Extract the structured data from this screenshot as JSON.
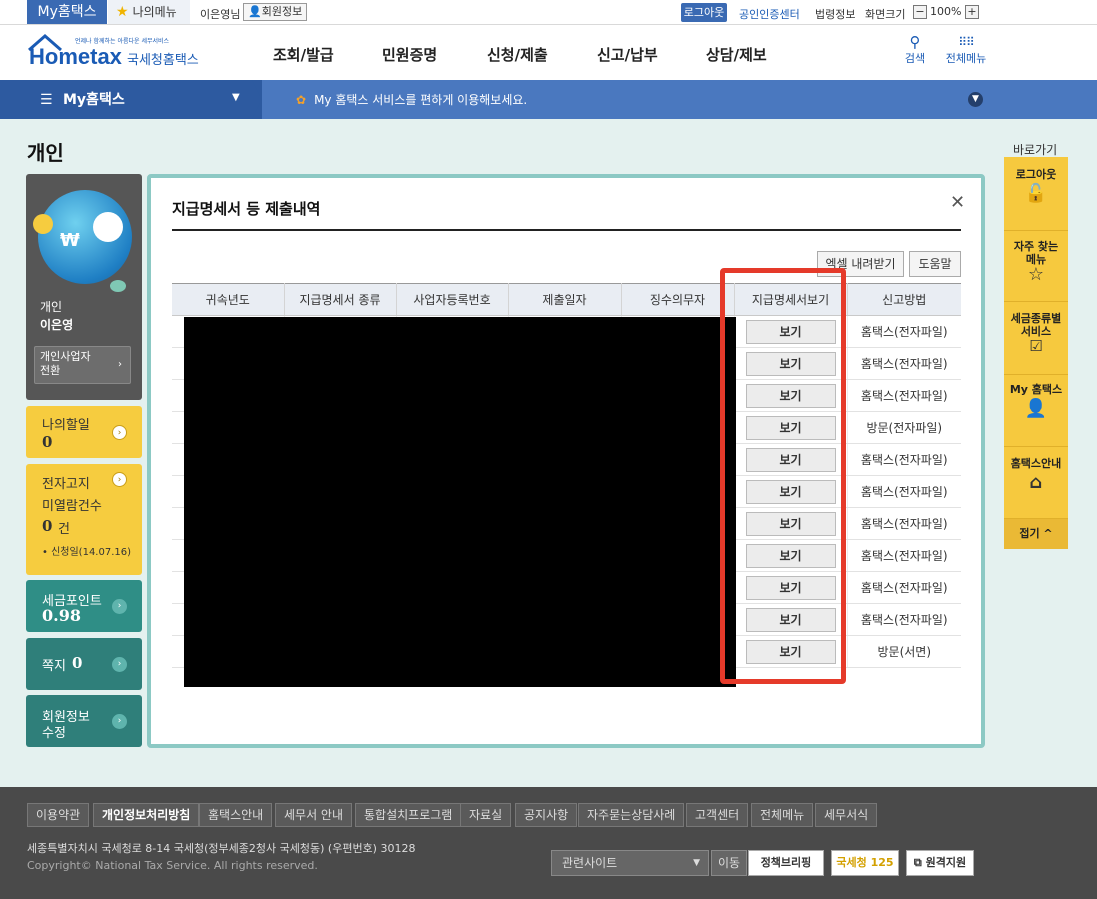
{
  "topbar": {
    "myhometax": "My홈택스",
    "mymenu": "나의메뉴",
    "user": "이은영님",
    "member_info": "회원정보",
    "logout": "로그아웃",
    "cert_center": "공인인증센터",
    "law_info": "법령정보",
    "screen_size": "화면크기",
    "zoom": "100%"
  },
  "header": {
    "logo_small": "언제나 함께하는 아름다운 세무서비스",
    "logo_main": "Hometax",
    "logo_sub": "국세청홈택스",
    "nav": [
      "조회/발급",
      "민원증명",
      "신청/제출",
      "신고/납부",
      "상담/제보"
    ],
    "search": "검색",
    "allmenu": "전체메뉴"
  },
  "bluebar": {
    "dropdown": "My홈택스",
    "message": "My 홈택스 서비스를 편하게 이용해보세요."
  },
  "page_title": "개인",
  "sidebar": {
    "profile_type": "개인",
    "profile_name": "이은영",
    "biz_switch": "개인사업자 전환",
    "todo_label": "나의할일",
    "todo_value": "0",
    "notice_label1": "전자고지",
    "notice_label2": "미열람건수",
    "notice_value": "0",
    "notice_unit": "건",
    "notice_date": "• 신청일(14.07.16)",
    "points_label": "세금포인트",
    "points_value": "0.98",
    "memo_label": "쪽지",
    "memo_value": "0",
    "member_edit_1": "회원정보",
    "member_edit_2": "수정"
  },
  "dialog": {
    "title": "지급명세서 등 제출내역",
    "excel_btn": "엑셀 내려받기",
    "help_btn": "도움말",
    "columns": [
      "귀속년도",
      "지급명세서 종류",
      "사업자등록번호",
      "제출일자",
      "징수의무자",
      "지급명세서보기",
      "신고방법"
    ],
    "view_label": "보기",
    "rows": [
      {
        "method": "홈택스(전자파일)"
      },
      {
        "method": "홈택스(전자파일)"
      },
      {
        "method": "홈택스(전자파일)"
      },
      {
        "method": "방문(전자파일)"
      },
      {
        "method": "홈택스(전자파일)"
      },
      {
        "method": "홈택스(전자파일)"
      },
      {
        "method": "홈택스(전자파일)"
      },
      {
        "method": "홈택스(전자파일)"
      },
      {
        "method": "홈택스(전자파일)"
      },
      {
        "method": "홈택스(전자파일)"
      },
      {
        "method": "방문(서면)"
      }
    ]
  },
  "quick": {
    "title": "바로가기",
    "items": [
      "로그아웃",
      "자주 찾는 메뉴",
      "세금종류별 서비스",
      "My 홈택스",
      "홈택스안내"
    ],
    "fold": "접기 ^"
  },
  "footer": {
    "links": [
      "이용약관",
      "개인정보처리방침",
      "홈택스안내",
      "세무서 안내",
      "통합설치프로그램",
      "자료실",
      "공지사항",
      "자주묻는상담사례",
      "고객센터",
      "전체메뉴",
      "세무서식"
    ],
    "address": "세종특별자치시 국세청로 8-14 국세청(정부세종2청사 국세청동) (우편번호) 30128",
    "copyright": "Copyright© National Tax Service. All rights reserved.",
    "related": "관련사이트",
    "move": "이동",
    "badge1": "정책브리핑",
    "badge2": "국세청 125",
    "badge3": "원격지원"
  }
}
